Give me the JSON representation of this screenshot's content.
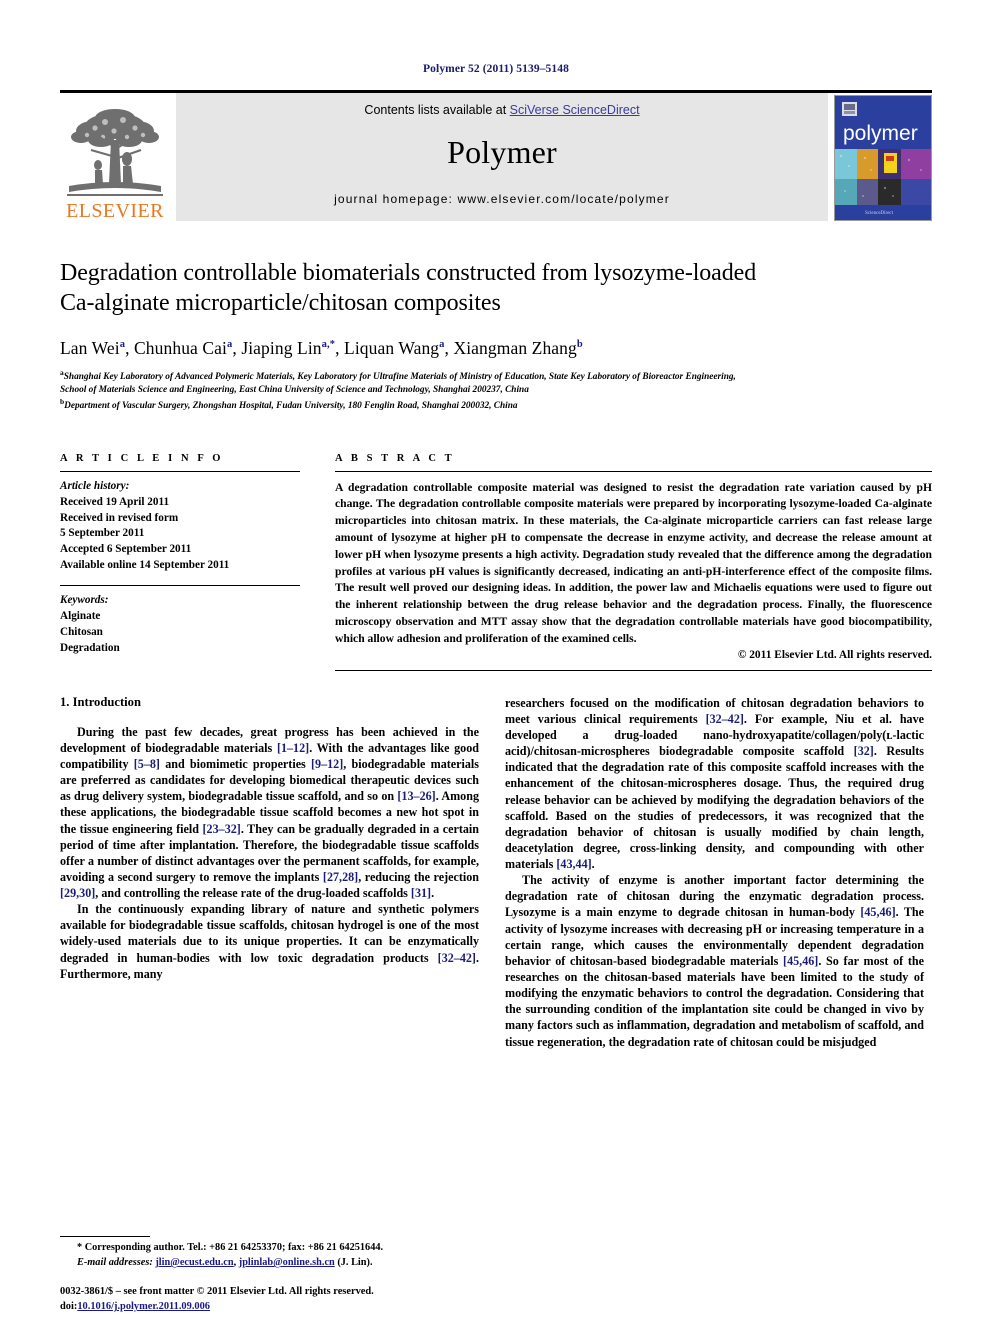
{
  "running_head": "Polymer 52 (2011) 5139–5148",
  "masthead": {
    "elsevier_wordmark": "ELSEVIER",
    "contents_prefix": "Contents lists available at ",
    "contents_link": "SciVerse ScienceDirect",
    "journal_name": "Polymer",
    "homepage": "journal homepage: www.elsevier.com/locate/polymer",
    "cover_title": "polymer",
    "accent_orange": "#E87722",
    "link_blue": "#3b3b9e",
    "band_gray": "#e6e6e6",
    "cover_blue": "#2b3f9e"
  },
  "article": {
    "title_line1": "Degradation controllable biomaterials constructed from lysozyme-loaded",
    "title_line2": "Ca-alginate microparticle/chitosan composites",
    "authors": [
      {
        "name": "Lan Wei",
        "sup": "a",
        "sep": ", "
      },
      {
        "name": "Chunhua Cai",
        "sup": "a",
        "sep": ", "
      },
      {
        "name": "Jiaping Lin",
        "sup": "a,*",
        "sep": ", "
      },
      {
        "name": "Liquan Wang",
        "sup": "a",
        "sep": ", "
      },
      {
        "name": "Xiangman Zhang",
        "sup": "b",
        "sep": ""
      }
    ],
    "affiliation_a_mark": "a",
    "affiliation_a_line1": "Shanghai Key Laboratory of Advanced Polymeric Materials, Key Laboratory for Ultrafine Materials of Ministry of Education, State Key Laboratory of Bioreactor Engineering,",
    "affiliation_a_line2": "School of Materials Science and Engineering, East China University of Science and Technology, Shanghai 200237, China",
    "affiliation_b_mark": "b",
    "affiliation_b_line": "Department of Vascular Surgery, Zhongshan Hospital, Fudan University, 180 Fenglin Road, Shanghai 200032, China"
  },
  "article_info": {
    "heading": "A R T I C L E  I N F O",
    "history_label": "Article history:",
    "history": [
      "Received 19 April 2011",
      "Received in revised form",
      "5 September 2011",
      "Accepted 6 September 2011",
      "Available online 14 September 2011"
    ],
    "keywords_label": "Keywords:",
    "keywords": [
      "Alginate",
      "Chitosan",
      "Degradation"
    ]
  },
  "abstract": {
    "heading": "A B S T R A C T",
    "text": "A degradation controllable composite material was designed to resist the degradation rate variation caused by pH change. The degradation controllable composite materials were prepared by incorporating lysozyme-loaded Ca-alginate microparticles into chitosan matrix. In these materials, the Ca-alginate microparticle carriers can fast release large amount of lysozyme at higher pH to compensate the decrease in enzyme activity, and decrease the release amount at lower pH when lysozyme presents a high activity. Degradation study revealed that the difference among the degradation profiles at various pH values is significantly decreased, indicating an anti-pH-interference effect of the composite films. The result well proved our designing ideas. In addition, the power law and Michaelis equations were used to figure out the inherent relationship between the drug release behavior and the degradation process. Finally, the fluorescence microscopy observation and MTT assay show that the degradation controllable materials have good biocompatibility, which allow adhesion and proliferation of the examined cells.",
    "copyright": "© 2011 Elsevier Ltd. All rights reserved."
  },
  "body": {
    "section_title": "1. Introduction",
    "left_paragraphs": [
      "During the past few decades, great progress has been achieved in the development of biodegradable materials [1–12]. With the advantages like good compatibility [5–8] and biomimetic properties [9–12], biodegradable materials are preferred as candidates for developing biomedical therapeutic devices such as drug delivery system, biodegradable tissue scaffold, and so on [13–26]. Among these applications, the biodegradable tissue scaffold becomes a new hot spot in the tissue engineering field [23–32]. They can be gradually degraded in a certain period of time after implantation. Therefore, the biodegradable tissue scaffolds offer a number of distinct advantages over the permanent scaffolds, for example, avoiding a second surgery to remove the implants [27,28], reducing the rejection [29,30], and controlling the release rate of the drug-loaded scaffolds [31].",
      "In the continuously expanding library of nature and synthetic polymers available for biodegradable tissue scaffolds, chitosan hydrogel is one of the most widely-used materials due to its unique properties. It can be enzymatically degraded in human-bodies with low toxic degradation products [32–42]. Furthermore, many"
    ],
    "right_paragraphs": [
      "researchers focused on the modification of chitosan degradation behaviors to meet various clinical requirements [32–42]. For example, Niu et al. have developed a drug-loaded nano-hydroxyapatite/collagen/poly(ʟ-lactic acid)/chitosan-microspheres biodegradable composite scaffold [32]. Results indicated that the degradation rate of this composite scaffold increases with the enhancement of the chitosan-microspheres dosage. Thus, the required drug release behavior can be achieved by modifying the degradation behaviors of the scaffold. Based on the studies of predecessors, it was recognized that the degradation behavior of chitosan is usually modified by chain length, deacetylation degree, cross-linking density, and compounding with other materials [43,44].",
      "The activity of enzyme is another important factor determining the degradation rate of chitosan during the enzymatic degradation process. Lysozyme is a main enzyme to degrade chitosan in human-body [45,46]. The activity of lysozyme increases with decreasing pH or increasing temperature in a certain range, which causes the environmentally dependent degradation behavior of chitosan-based biodegradable materials [45,46]. So far most of the researches on the chitosan-based materials have been limited to the study of modifying the enzymatic behaviors to control the degradation. Considering that the surrounding condition of the implantation site could be changed in vivo by many factors such as inflammation, degradation and metabolism of scaffold, and tissue regeneration, the degradation rate of chitosan could be misjudged"
    ]
  },
  "footnote": {
    "corresponding": "* Corresponding author. Tel.: +86 21 64253370; fax: +86 21 64251644.",
    "email_label": "E-mail addresses:",
    "email1": "jlin@ecust.edu.cn",
    "email_sep": ", ",
    "email2": "jplinlab@online.sh.cn",
    "email_suffix": " (J. Lin)."
  },
  "imprint": {
    "line1": "0032-3861/$ – see front matter © 2011 Elsevier Ltd. All rights reserved.",
    "doi_prefix": "doi:",
    "doi_value": "10.1016/j.polymer.2011.09.006"
  }
}
